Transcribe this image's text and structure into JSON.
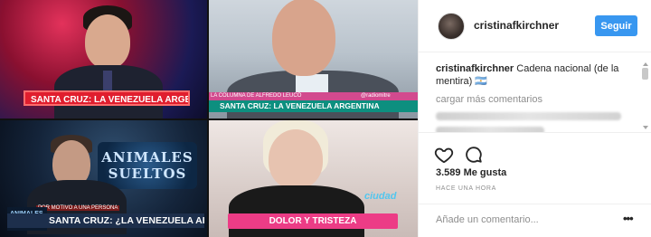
{
  "media": {
    "chyron_1": "SANTA CRUZ: LA VENEZUELA ARGENTINA",
    "chyron_2": "SANTA CRUZ: LA VENEZUELA ARGENTINA",
    "chyron_3": "SANTA CRUZ: ¿LA VENEZUELA ARGENTINA?",
    "chyron_4": "DOLOR Y TRISTEZA",
    "sign_text": "ANIMALES SUELTOS",
    "tag_text": "ANIMALES SUELTOS",
    "overlay_1": "LA COLUMNA DE ALFREDO LEUCO",
    "overlay_2": "@radiomitre",
    "overlay_3": "POR MOTIVO A UNA PERSONA",
    "logo_text": "ciudad"
  },
  "profile": {
    "username": "cristinafkirchner",
    "follow_label": "Seguir"
  },
  "comments": {
    "author": "cristinafkirchner",
    "text": "Cadena nacional (de la mentira)",
    "flags": "🇦🇷",
    "load_more": "cargar más comentarios"
  },
  "stats": {
    "likes": "3.589 Me gusta",
    "timestamp": "HACE UNA HORA"
  },
  "composer": {
    "placeholder": "Añade un comentario...",
    "more_label": "•••"
  },
  "colors": {
    "follow_button": "#3897f0",
    "muted_text": "#8e8e8e",
    "chyron_red": "#e01e2e",
    "chyron_pink": "#ec3c86"
  },
  "icons": [
    "heart-icon",
    "comment-icon",
    "more-options-icon"
  ]
}
